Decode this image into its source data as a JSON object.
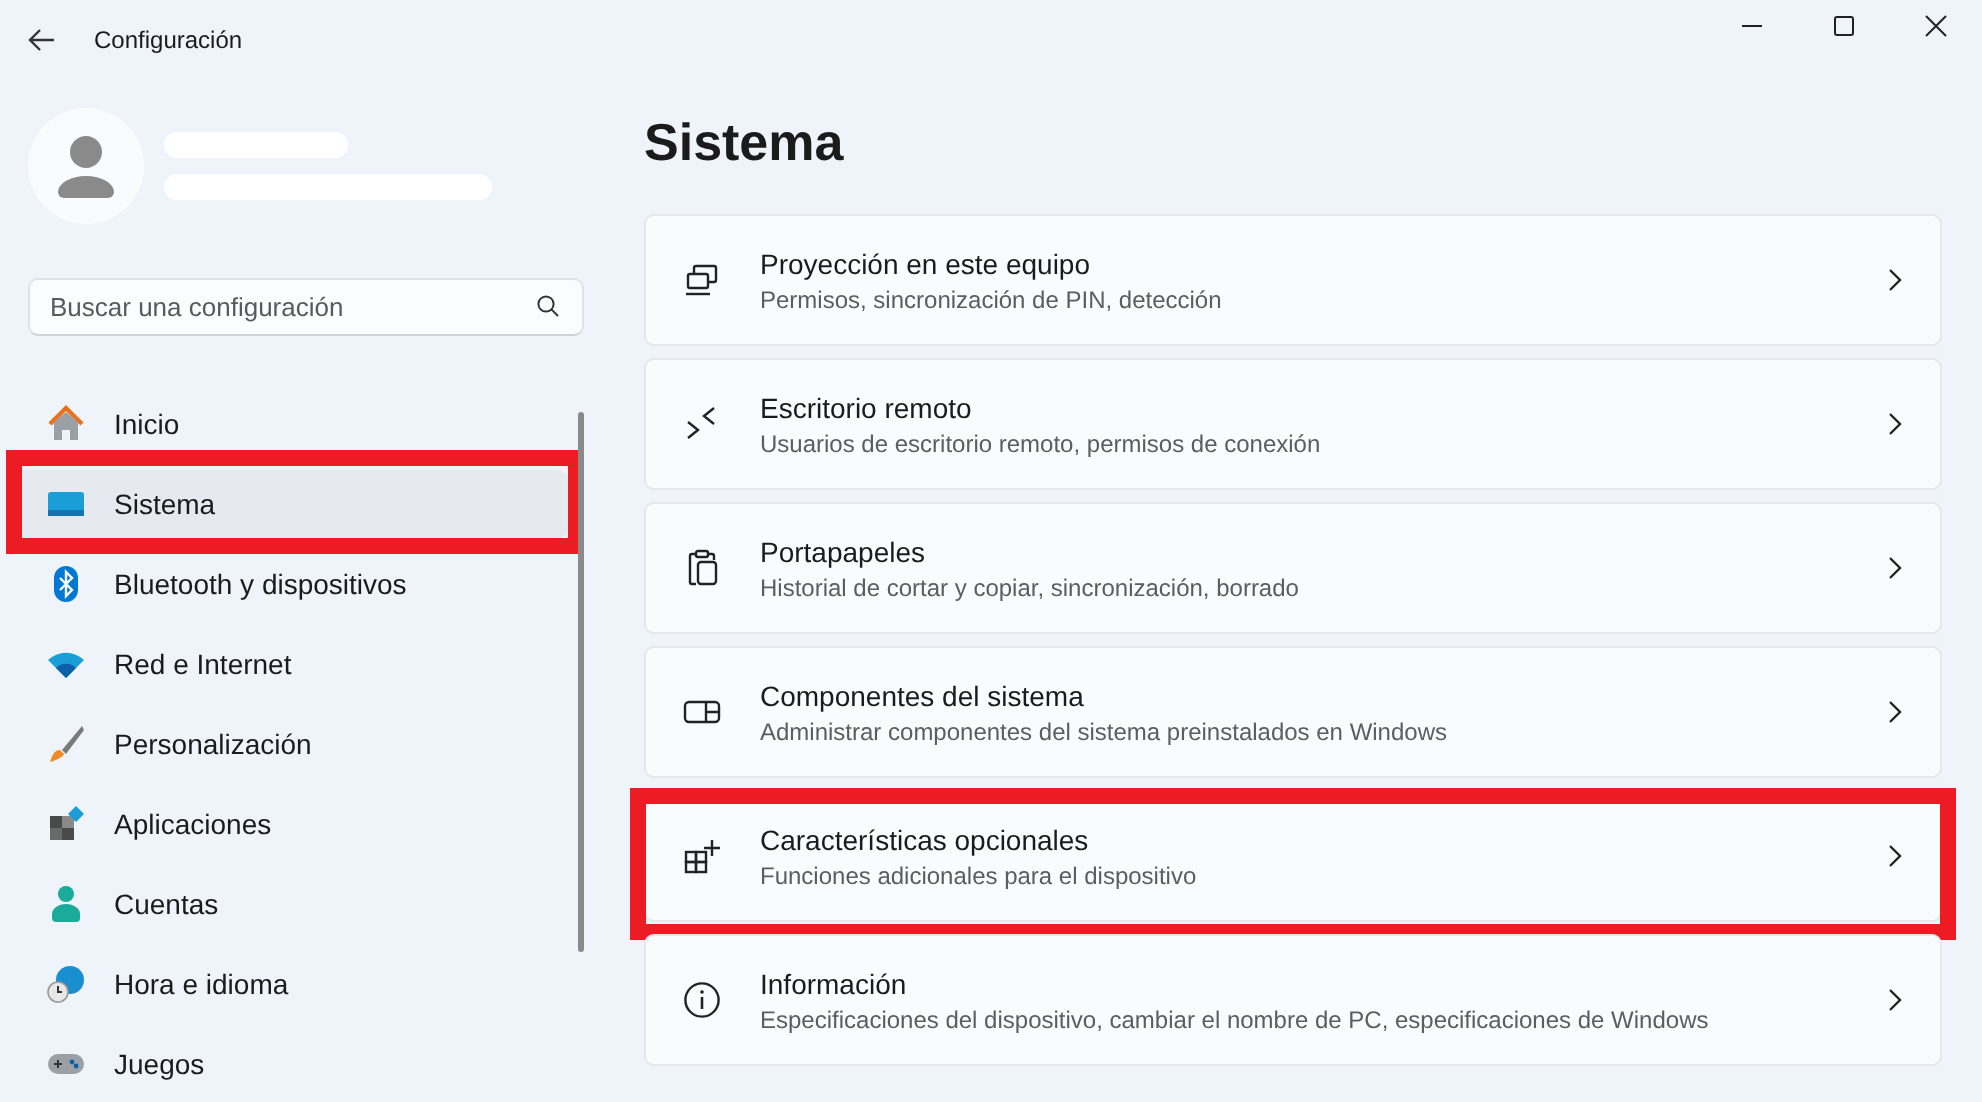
{
  "window": {
    "title": "Configuración"
  },
  "search": {
    "placeholder": "Buscar una configuración"
  },
  "nav": [
    {
      "label": "Inicio",
      "selected": false,
      "highlighted": false
    },
    {
      "label": "Sistema",
      "selected": true,
      "highlighted": true
    },
    {
      "label": "Bluetooth y dispositivos",
      "selected": false,
      "highlighted": false
    },
    {
      "label": "Red e Internet",
      "selected": false,
      "highlighted": false
    },
    {
      "label": "Personalización",
      "selected": false,
      "highlighted": false
    },
    {
      "label": "Aplicaciones",
      "selected": false,
      "highlighted": false
    },
    {
      "label": "Cuentas",
      "selected": false,
      "highlighted": false
    },
    {
      "label": "Hora e idioma",
      "selected": false,
      "highlighted": false
    },
    {
      "label": "Juegos",
      "selected": false,
      "highlighted": false
    }
  ],
  "page_title": "Sistema",
  "cards": [
    {
      "title": "Proyección en este equipo",
      "subtitle": "Permisos, sincronización de PIN, detección",
      "highlighted": false
    },
    {
      "title": "Escritorio remoto",
      "subtitle": "Usuarios de escritorio remoto, permisos de conexión",
      "highlighted": false
    },
    {
      "title": "Portapapeles",
      "subtitle": "Historial de cortar y copiar, sincronización, borrado",
      "highlighted": false
    },
    {
      "title": "Componentes del sistema",
      "subtitle": "Administrar componentes del sistema preinstalados en Windows",
      "highlighted": false
    },
    {
      "title": "Características opcionales",
      "subtitle": "Funciones adicionales para el dispositivo",
      "highlighted": true
    },
    {
      "title": "Información",
      "subtitle": "Especificaciones del dispositivo, cambiar el nombre de PC, especificaciones de Windows",
      "highlighted": false
    }
  ]
}
